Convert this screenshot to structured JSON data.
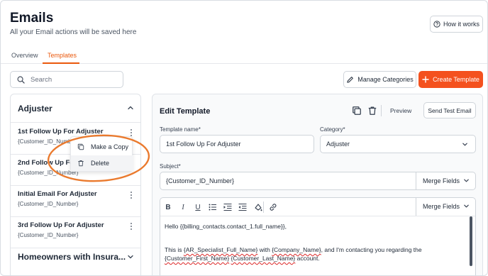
{
  "page": {
    "title": "Emails",
    "subtitle": "All your Email actions will be saved here",
    "how_it_works": "How it works"
  },
  "tabs": [
    {
      "label": "Overview",
      "active": false
    },
    {
      "label": "Templates",
      "active": true
    }
  ],
  "toolbar": {
    "search_placeholder": "Search",
    "manage_categories": "Manage Categories",
    "create_template": "Create Template"
  },
  "colors": {
    "accent": "#f4511e",
    "tab_active": "#ea580c",
    "highlight_ring": "#ea7a2e"
  },
  "sidebar": {
    "category": "Adjuster",
    "templates": [
      {
        "name": "1st Follow Up For Adjuster",
        "sub": "{Customer_ID_Number}"
      },
      {
        "name": "2nd Follow Up For Adjuster",
        "sub": "{Customer_ID_Number}"
      },
      {
        "name": "Initial Email For Adjuster",
        "sub": "{Customer_ID_Number}"
      },
      {
        "name": "3rd Follow Up For Adjuster",
        "sub": "{Customer_ID_Number}"
      }
    ],
    "category2": "Homeowners with Insura..."
  },
  "context_menu": {
    "make_copy": "Make a Copy",
    "delete": "Delete"
  },
  "editor": {
    "heading": "Edit Template",
    "preview": "Preview",
    "send_test": "Send Test Email",
    "template_name_label": "Template name*",
    "template_name_value": "1st Follow Up For Adjuster",
    "category_label": "Category*",
    "category_value": "Adjuster",
    "subject_label": "Subject*",
    "subject_value": "{Customer_ID_Number}",
    "merge_fields": "Merge Fields",
    "body": {
      "line1": "Hello {{billing_contacts.contact_1.full_name}},",
      "line2_a": "This is ",
      "line2_b": "{AR_Specialist_Full_Name}",
      "line2_c": " with ",
      "line2_d": "{Company_Name}",
      "line2_e": ", and I'm contacting you regarding the",
      "line3_a": "{Customer_First_Name}",
      "line3_b": " ",
      "line3_c": "{Customer_Last_Name}",
      "line3_d": " account."
    }
  }
}
